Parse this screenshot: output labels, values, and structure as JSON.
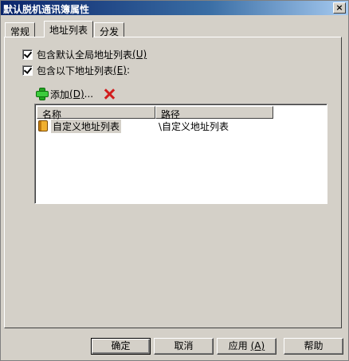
{
  "window": {
    "title": "默认脱机通讯簿属性",
    "close_glyph": "×"
  },
  "tabs": [
    {
      "label": "常规"
    },
    {
      "label": "地址列表"
    },
    {
      "label": "分发"
    }
  ],
  "options": {
    "include_default": {
      "label": "包含默认全局地址列表",
      "hotkey": "(U)",
      "checked": true
    },
    "include_lists": {
      "label": "包含以下地址列表",
      "hotkey": "(E)",
      "suffix": ":",
      "checked": true
    }
  },
  "toolbar": {
    "add_label": "添加",
    "add_hotkey": "(D)",
    "add_ellipsis": "..."
  },
  "list": {
    "columns": [
      "名称",
      "路径"
    ],
    "rows": [
      {
        "name": "自定义地址列表",
        "path": "\\自定义地址列表"
      }
    ]
  },
  "buttons": {
    "ok": "确定",
    "cancel": "取消",
    "apply": "应用",
    "apply_hotkey": "(A)",
    "help": "帮助"
  }
}
